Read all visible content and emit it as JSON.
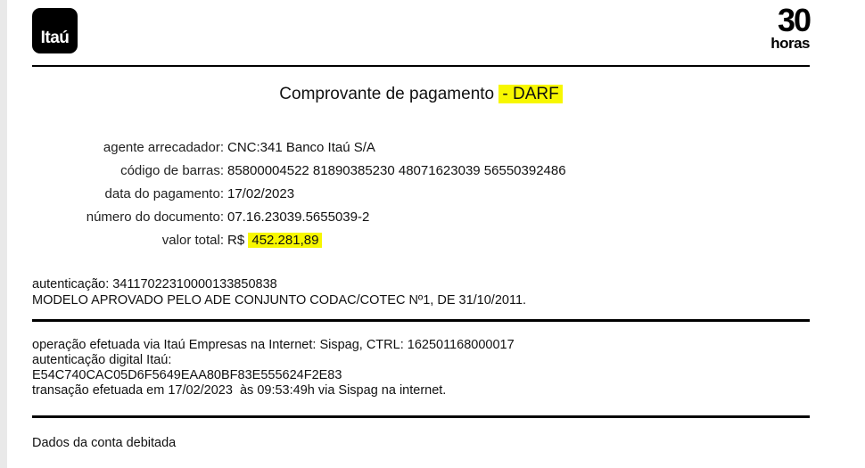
{
  "header": {
    "logo_left": "Itaú",
    "logo_right_number": "30",
    "logo_right_word": "horas"
  },
  "receipt": {
    "title_prefix": "Comprovante de pagamento",
    "title_highlight": "- DARF",
    "fields": [
      {
        "label": "agente arrecadador:",
        "value": "CNC:341 Banco Itaú S/A"
      },
      {
        "label": "código de barras:",
        "value": "85800004522 81890385230 48071623039 56550392486"
      },
      {
        "label": "data do pagamento:",
        "value": "17/02/2023"
      },
      {
        "label": "número do documento:",
        "value": "07.16.23039.5655039-2"
      }
    ],
    "total_label": "valor total:",
    "total_currency": "R$",
    "total_value": "452.281,89",
    "authentication_label": "autenticação:",
    "authentication_value": "3411702231000013385083­8",
    "model_note": "MODELO APROVADO PELO ADE CONJUNTO CODAC/COTEC Nº1, DE 31/10/2011."
  },
  "operation": {
    "line1_text": "operação efetuada via Itaú Empresas na Internet:",
    "line1_value": "Sispag, CTRL: 162501168000017",
    "digital_auth_label": "autenticação digital Itaú:",
    "digital_auth_value": "E54C740CAC05D6F5649EAA80BF83E555624F2E83",
    "transaction_line": "transação efetuada em 17/02/2023  às 09:53:49h via Sispag na internet."
  },
  "debit": {
    "title": "Dados da conta debitada"
  },
  "colors": {
    "highlight": "#f7f700",
    "logo_bg": "#000000"
  }
}
